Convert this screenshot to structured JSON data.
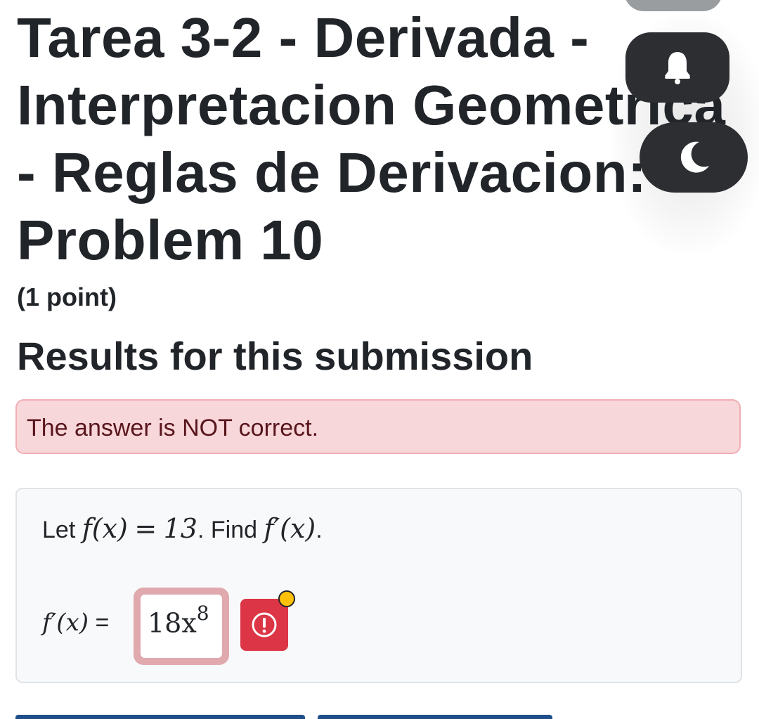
{
  "title_lines": [
    "Tarea 3-2 - Derivada -",
    "Interpretacion Geometrica",
    "- Reglas de Derivacion:",
    "Problem 10"
  ],
  "points": "(1 point)",
  "results_heading": "Results for this submission",
  "alert_text": "The answer is NOT correct.",
  "problem": {
    "let_text": "Let",
    "func": "f(x)",
    "equals": "=",
    "value": "13",
    "find_text": ". Find",
    "target": "f′(x)",
    "period": "."
  },
  "answer": {
    "label": "f′(x)",
    "equals": "=",
    "base": "18x",
    "exponent": "8"
  },
  "icons": {
    "warning": "exclamation-circle-icon",
    "bell": "bell-icon",
    "moon": "moon-icon",
    "badge": "notification-dot-icon"
  },
  "colors": {
    "alert_bg": "#f8d7da",
    "alert_text": "#58151c",
    "danger": "#dc3545",
    "badge": "#ffc107",
    "widget": "#2c2e32"
  }
}
